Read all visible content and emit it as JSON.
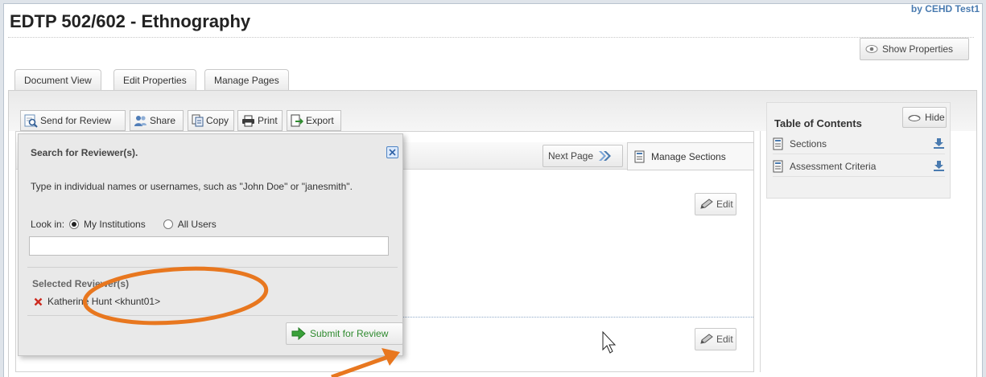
{
  "header": {
    "title": "EDTP 502/602 - Ethnography",
    "byline": "by CEHD Test1",
    "show_properties_label": "Show Properties"
  },
  "tabs": [
    {
      "label": "Document View",
      "active": true
    },
    {
      "label": "Edit Properties",
      "active": false
    },
    {
      "label": "Manage Pages",
      "active": false
    }
  ],
  "toolbar": {
    "send_for_review": "Send for Review",
    "share": "Share",
    "copy": "Copy",
    "print": "Print",
    "export": "Export"
  },
  "navigation": {
    "next_page": "Next Page",
    "manage_sections": "Manage Sections",
    "edit_label": "Edit"
  },
  "toc": {
    "title": "Table of Contents",
    "hide_label": "Hide",
    "items": [
      {
        "label": "Sections"
      },
      {
        "label": "Assessment Criteria"
      }
    ]
  },
  "review_popup": {
    "title": "Search for Reviewer(s).",
    "instructions": "Type in individual names or usernames, such as \"John Doe\" or \"janesmith\".",
    "look_in_label": "Look in:",
    "options": [
      {
        "label": "My Institutions",
        "checked": true
      },
      {
        "label": "All Users",
        "checked": false
      }
    ],
    "search_value": "",
    "selected_heading": "Selected Reviewer(s)",
    "selected_reviewers": [
      "Katherine Hunt <khunt01>"
    ],
    "submit_label": "Submit for Review"
  },
  "colors": {
    "accent_blue": "#4a7bb0",
    "annotation_orange": "#e8771f",
    "submit_green": "#2f8a2f",
    "remove_red": "#cc2a1f"
  }
}
